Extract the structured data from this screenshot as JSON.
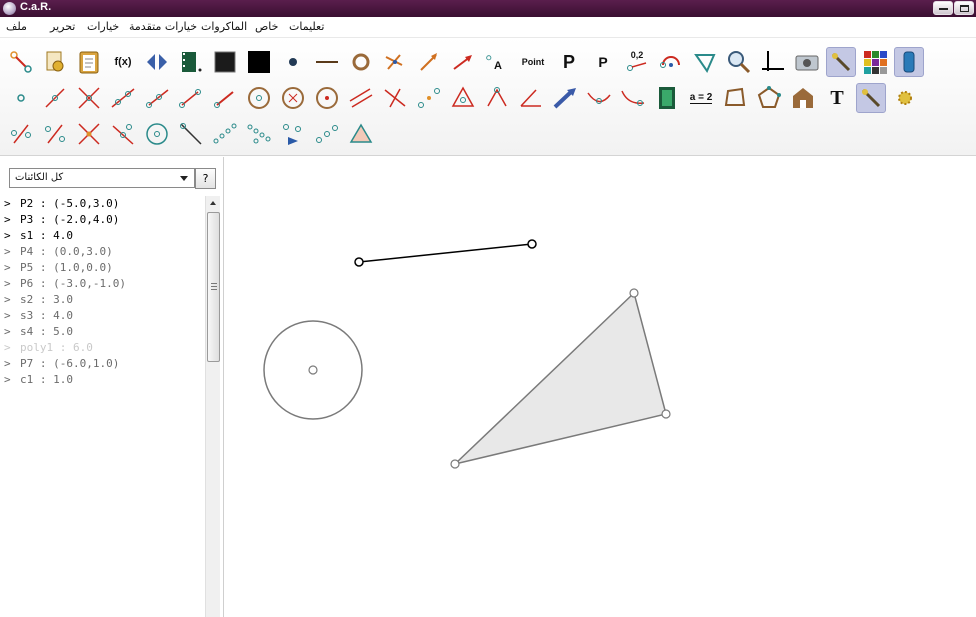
{
  "window": {
    "title": "C.a.R."
  },
  "menu": {
    "items": [
      {
        "id": "file",
        "label": "ملف"
      },
      {
        "id": "edit",
        "label": "تحرير"
      },
      {
        "id": "options",
        "label": "خيارات"
      },
      {
        "id": "advanced",
        "label": "خيارات متقدمة"
      },
      {
        "id": "macros",
        "label": "الماكروات"
      },
      {
        "id": "special",
        "label": "خاص"
      },
      {
        "id": "help",
        "label": "تعليمات"
      }
    ]
  },
  "toolbar": {
    "row1": [
      "arrow-point-icon",
      "macro-gear-icon",
      "clipboard-icon",
      "function-icon",
      "reflect-icon",
      "film-icon",
      "filled-square-icon",
      "black-square-icon",
      "dot-icon",
      "line-style-icon",
      "circle-style-icon",
      "arrows-icon",
      "arrow-icon",
      "arrow-red-icon",
      "point-label-icon",
      "point-text-icon",
      "p-bold-icon",
      "p-small-icon",
      "value-icon",
      "arc-icon",
      "triangle-check-icon",
      "zoom-icon",
      "axes-icon",
      "camera-icon",
      "wand-icon",
      "palette-icon",
      "tube-icon"
    ],
    "row2": [
      "point-icon",
      "segment-icon",
      "intersection-icon",
      "line-icon",
      "ray-icon",
      "vector-icon",
      "fixed-segment-icon",
      "circle-icon",
      "circle3-icon",
      "fixed-circle-icon",
      "parallel-icon",
      "perpendicular-icon",
      "midpoint-icon",
      "triangle-icon",
      "angle-icon",
      "fixed-angle-icon",
      "move-icon",
      "curve-icon",
      "function-graph-icon",
      "animation-icon",
      "expression-icon",
      "polygon-icon",
      "polygon-points-icon",
      "house-icon",
      "text-icon",
      "wand-active-icon",
      "star-icon"
    ],
    "row3": [
      "reflection-icon",
      "rotation-icon",
      "cross-icon",
      "tangent-icon",
      "circle-center-icon",
      "slash-icon",
      "locus-icon",
      "points-chain-icon",
      "transform-icon",
      "points-icon",
      "triangle-fill-icon"
    ],
    "labels": {
      "function": "f(x)",
      "point": "Point",
      "p_bold": "P",
      "p_small": "P",
      "value": "0,2",
      "expression": "a = 2",
      "text": "T",
      "point_label": "A"
    },
    "colors": {
      "accent": "#2a8a8a",
      "point_orange": "#e0902a",
      "red": "#cc2a20",
      "active_bg": "#c4c8e4"
    }
  },
  "sidebar": {
    "filter_value": "كل الكائنات",
    "help_label": "?",
    "objects": [
      {
        "name": "P2",
        "value": "(-5.0,3.0)",
        "style": "black"
      },
      {
        "name": "P3",
        "value": "(-2.0,4.0)",
        "style": "black"
      },
      {
        "name": "s1",
        "value": "4.0",
        "style": "black"
      },
      {
        "name": "P4",
        "value": "(0.0,3.0)",
        "style": "gray"
      },
      {
        "name": "P5",
        "value": "(1.0,0.0)",
        "style": "gray"
      },
      {
        "name": "P6",
        "value": "(-3.0,-1.0)",
        "style": "gray"
      },
      {
        "name": "s2",
        "value": "3.0",
        "style": "gray"
      },
      {
        "name": "s3",
        "value": "4.0",
        "style": "gray"
      },
      {
        "name": "s4",
        "value": "5.0",
        "style": "gray"
      },
      {
        "name": "poly1",
        "value": "6.0",
        "style": "light"
      },
      {
        "name": "P7",
        "value": "(-6.0,1.0)",
        "style": "gray"
      },
      {
        "name": "c1",
        "value": "1.0",
        "style": "gray"
      }
    ],
    "prompt": ">"
  },
  "canvas": {
    "segment_color": "#000000",
    "shape_color": "#7a7a7a",
    "polygon_fill": "#e8e8e8",
    "background": "#ffffff"
  }
}
